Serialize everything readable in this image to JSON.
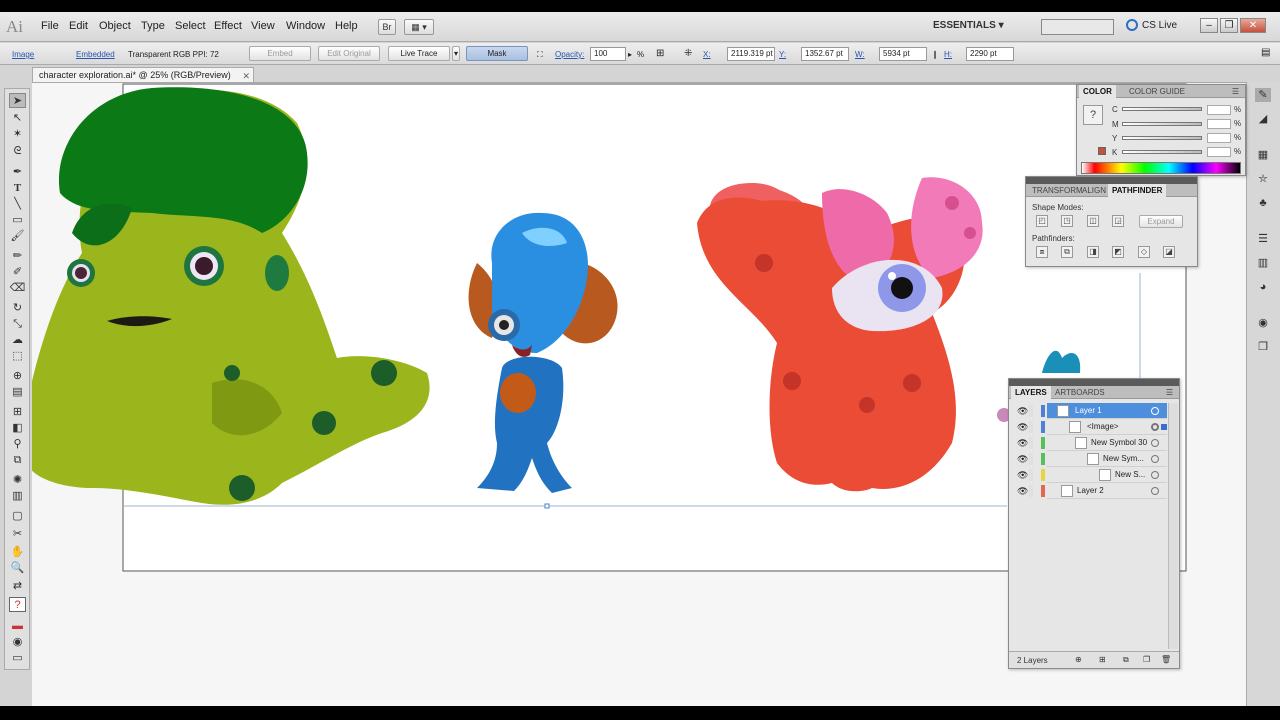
{
  "app": {
    "logo": "Ai",
    "workspace": "ESSENTIALS",
    "cslive": "CS Live"
  },
  "menu": [
    "File",
    "Edit",
    "Object",
    "Type",
    "Select",
    "Effect",
    "View",
    "Window",
    "Help"
  ],
  "menubar_buttons": {
    "bridge": "Br"
  },
  "control": {
    "image_label": "Image",
    "embedded_label": "Embedded",
    "color_info": "Transparent RGB  PPI: 72",
    "embed_button": "Embed",
    "edit_original_button": "Edit Original",
    "live_trace_button": "Live Trace",
    "mask_button": "Mask",
    "opacity_label": "Opacity:",
    "opacity_value": "100",
    "opacity_unit": "%",
    "x_label": "X:",
    "x_value": "2119.319 pt",
    "y_label": "Y:",
    "y_value": "1352.67 pt",
    "w_label": "W:",
    "w_value": "5934 pt",
    "h_label": "H:",
    "h_value": "2290 pt"
  },
  "document": {
    "tab_title": "character exploration.ai* @ 25% (RGB/Preview)"
  },
  "color_panel": {
    "tabs": [
      "COLOR",
      "COLOR GUIDE"
    ],
    "channels": [
      "C",
      "M",
      "Y",
      "K"
    ],
    "pct": "%",
    "accent": "#c5503c"
  },
  "pathfinder_panel": {
    "tabs": [
      "TRANSFORM",
      "ALIGN",
      "PATHFINDER"
    ],
    "shape_modes_label": "Shape Modes:",
    "pathfinders_label": "Pathfinders:",
    "expand_button": "Expand"
  },
  "layers_panel": {
    "tabs": [
      "LAYERS",
      "ARTBOARDS"
    ],
    "rows": [
      {
        "name": "Layer 1",
        "color": "#4f7fd8"
      },
      {
        "name": "<Image>",
        "color": "#4f7fd8"
      },
      {
        "name": "New Symbol 30",
        "color": "#58c058"
      },
      {
        "name": "New Sym...",
        "color": "#58c058"
      },
      {
        "name": "New S...",
        "color": "#e6d640"
      },
      {
        "name": "Layer 2",
        "color": "#e06a4a"
      }
    ],
    "footer": "2 Layers"
  }
}
